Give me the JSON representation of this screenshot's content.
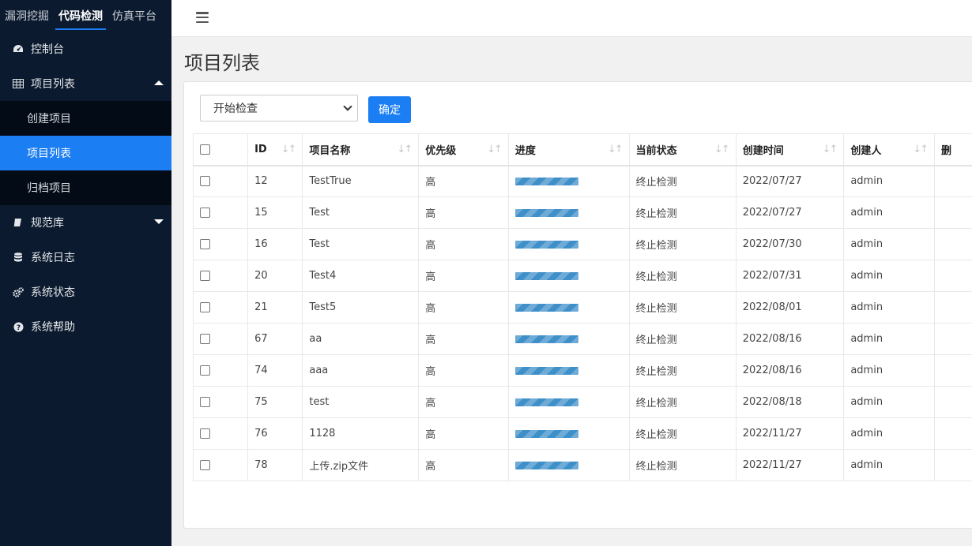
{
  "top_tabs": [
    {
      "label": "漏洞挖掘"
    },
    {
      "label": "代码检测"
    },
    {
      "label": "仿真平台"
    }
  ],
  "sidebar": {
    "items": [
      {
        "label": "控制台",
        "icon": "dashboard-icon"
      },
      {
        "label": "项目列表",
        "icon": "table-icon",
        "expanded": true,
        "children": [
          {
            "label": "创建项目"
          },
          {
            "label": "项目列表"
          },
          {
            "label": "归档项目"
          }
        ]
      },
      {
        "label": "规范库",
        "icon": "book-icon",
        "expanded": false
      },
      {
        "label": "系统日志",
        "icon": "database-icon"
      },
      {
        "label": "系统状态",
        "icon": "gears-icon"
      },
      {
        "label": "系统帮助",
        "icon": "question-circle-icon"
      }
    ]
  },
  "page": {
    "title": "项目列表"
  },
  "toolbar": {
    "select_value": "开始检查",
    "confirm_label": "确定"
  },
  "table": {
    "headers": [
      "ID",
      "项目名称",
      "优先级",
      "进度",
      "当前状态",
      "创建时间",
      "创建人",
      "删"
    ],
    "rows": [
      {
        "id": "12",
        "name": "TestTrue",
        "priority": "高",
        "progress": 1.0,
        "status": "终止检测",
        "created": "2022/07/27",
        "creator": "admin"
      },
      {
        "id": "15",
        "name": "Test",
        "priority": "高",
        "progress": 1.0,
        "status": "终止检测",
        "created": "2022/07/27",
        "creator": "admin"
      },
      {
        "id": "16",
        "name": "Test",
        "priority": "高",
        "progress": 1.0,
        "status": "终止检测",
        "created": "2022/07/30",
        "creator": "admin"
      },
      {
        "id": "20",
        "name": "Test4",
        "priority": "高",
        "progress": 1.0,
        "status": "终止检测",
        "created": "2022/07/31",
        "creator": "admin"
      },
      {
        "id": "21",
        "name": "Test5",
        "priority": "高",
        "progress": 1.0,
        "status": "终止检测",
        "created": "2022/08/01",
        "creator": "admin"
      },
      {
        "id": "67",
        "name": "aa",
        "priority": "高",
        "progress": 1.0,
        "status": "终止检测",
        "created": "2022/08/16",
        "creator": "admin"
      },
      {
        "id": "74",
        "name": "aaa",
        "priority": "高",
        "progress": 1.0,
        "status": "终止检测",
        "created": "2022/08/16",
        "creator": "admin"
      },
      {
        "id": "75",
        "name": "test",
        "priority": "高",
        "progress": 1.0,
        "status": "终止检测",
        "created": "2022/08/18",
        "creator": "admin"
      },
      {
        "id": "76",
        "name": "1128",
        "priority": "高",
        "progress": 1.0,
        "status": "终止检测",
        "created": "2022/11/27",
        "creator": "admin"
      },
      {
        "id": "78",
        "name": "上传.zip文件",
        "priority": "高",
        "progress": 1.0,
        "status": "终止检测",
        "created": "2022/11/27",
        "creator": "admin"
      }
    ]
  },
  "colors": {
    "sidebar_bg": "#0b1a2e",
    "accent": "#1b7ef2",
    "progress": "#3f8fc9"
  }
}
